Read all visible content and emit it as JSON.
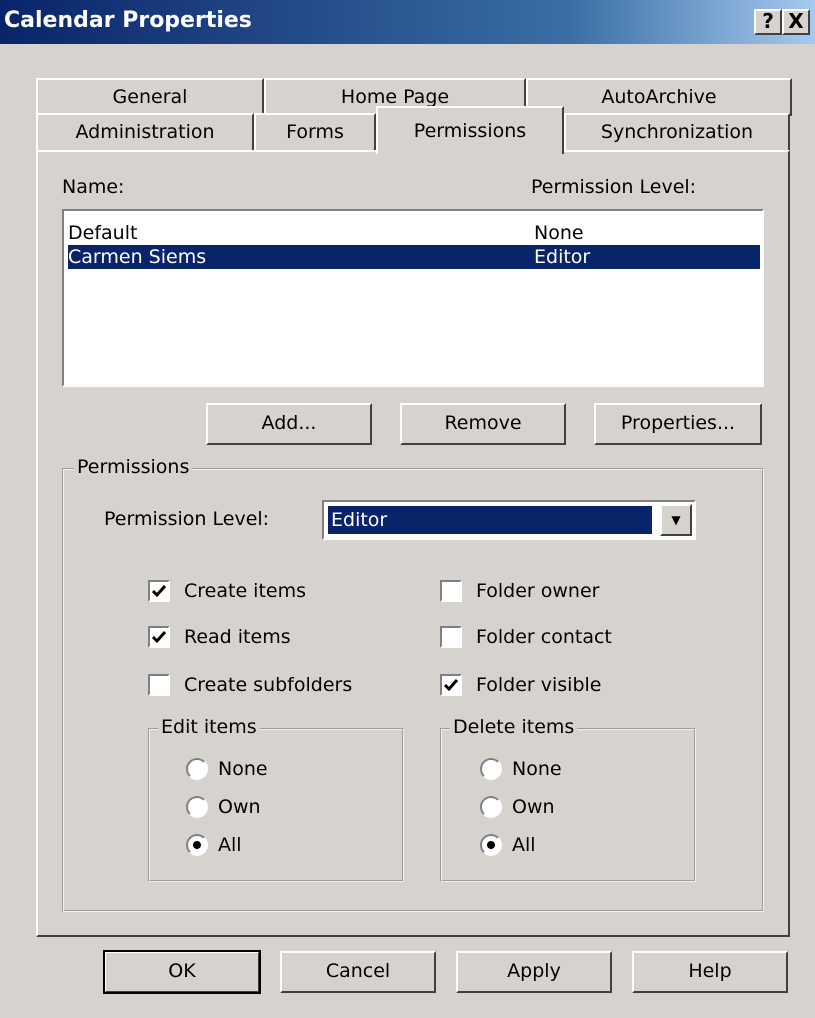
{
  "window": {
    "title": "Calendar Properties",
    "help_btn": "?",
    "close_btn": "X"
  },
  "tabs": {
    "row1": [
      "General",
      "Home Page",
      "AutoArchive"
    ],
    "row2": [
      "Administration",
      "Forms",
      "Permissions",
      "Synchronization"
    ],
    "active": "Permissions"
  },
  "list": {
    "name_header": "Name:",
    "level_header": "Permission Level:",
    "rows": [
      {
        "name": "Default",
        "level": "None",
        "selected": false
      },
      {
        "name": "Carmen Siems",
        "level": "Editor",
        "selected": true
      }
    ]
  },
  "list_buttons": {
    "add": "Add...",
    "remove": "Remove",
    "properties": "Properties..."
  },
  "permissions": {
    "group_title": "Permissions",
    "level_label": "Permission Level:",
    "level_value": "Editor",
    "checkboxes": {
      "create_items": {
        "label": "Create items",
        "checked": true
      },
      "read_items": {
        "label": "Read items",
        "checked": true
      },
      "create_subfolders": {
        "label": "Create subfolders",
        "checked": false
      },
      "folder_owner": {
        "label": "Folder owner",
        "checked": false
      },
      "folder_contact": {
        "label": "Folder contact",
        "checked": false
      },
      "folder_visible": {
        "label": "Folder visible",
        "checked": true
      }
    },
    "edit_items": {
      "title": "Edit items",
      "options": [
        "None",
        "Own",
        "All"
      ],
      "selected": "All"
    },
    "delete_items": {
      "title": "Delete items",
      "options": [
        "None",
        "Own",
        "All"
      ],
      "selected": "All"
    }
  },
  "footer": {
    "ok": "OK",
    "cancel": "Cancel",
    "apply": "Apply",
    "help": "Help"
  }
}
